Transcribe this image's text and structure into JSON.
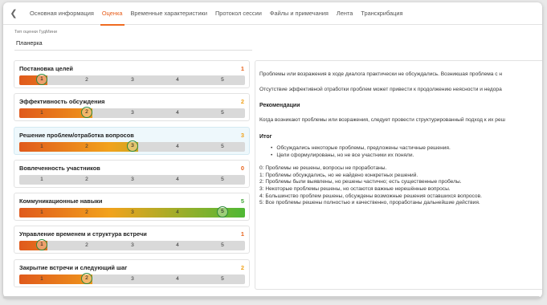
{
  "tabs": [
    {
      "label": "Основная информация",
      "active": false
    },
    {
      "label": "Оценка",
      "active": true
    },
    {
      "label": "Временные характеристики",
      "active": false
    },
    {
      "label": "Протокол сессии",
      "active": false
    },
    {
      "label": "Файлы и примечания",
      "active": false
    },
    {
      "label": "Лента",
      "active": false
    },
    {
      "label": "Транскрибация",
      "active": false
    }
  ],
  "meeting_type": {
    "label": "Тип оценки ГудМини",
    "value": "Планерка"
  },
  "scale_labels": [
    "1",
    "2",
    "3",
    "4",
    "5"
  ],
  "colors": {
    "accent": "#ef6b21",
    "low": "#e05a1c",
    "mid": "#f2a21c",
    "high": "#4fb835",
    "track": "#d9d9d9"
  },
  "criteria": [
    {
      "title": "Постановка целей",
      "score": "1",
      "value": 1,
      "score_color": "#e8631c",
      "selected": false
    },
    {
      "title": "Эффективность обсуждения",
      "score": "2",
      "value": 2,
      "score_color": "#f0a11a",
      "selected": false
    },
    {
      "title": "Решение проблем/отработка вопросов",
      "score": "3",
      "value": 3,
      "score_color": "#f0a11a",
      "selected": true
    },
    {
      "title": "Вовлеченность участников",
      "score": "0",
      "value": 0,
      "score_color": "#e8631c",
      "selected": false
    },
    {
      "title": "Коммуникационные навыки",
      "score": "5",
      "value": 5,
      "score_color": "#45a83a",
      "selected": false
    },
    {
      "title": "Управление временем и структура встречи",
      "score": "1",
      "value": 1,
      "score_color": "#e8631c",
      "selected": false
    },
    {
      "title": "Закрытие встречи и следующий шаг",
      "score": "2",
      "value": 2,
      "score_color": "#f0a11a",
      "selected": false
    }
  ],
  "panel": {
    "p1": "Проблемы или возражения в ходе диалога практически не обсуждались. Возникшая проблема с н",
    "p2": "Отсутствие эффективной отработки проблем может привести к продолжению неясности и недора",
    "rec_heading": "Рекомендации",
    "rec_text": "Когда возникают проблемы или возражения, следует провести структурированный подход к их реш",
    "summary_heading": "Итог",
    "bullets": [
      "Обсуждались некоторые проблемы, предложены частичные решения.",
      "Цели сформулированы, но не все участники их поняли."
    ],
    "legend": [
      "0: Проблемы не решены, вопросы не проработаны.",
      "1: Проблемы обсуждались, но не найдено конкретных решений.",
      "2: Проблемы были выявлены, но решены частично; есть существенные пробелы.",
      "3: Некоторые проблемы решены, но остаются важные нерешённые вопросы.",
      "4: Большинство проблем решены, обсуждены возможные решения оставшихся вопросов.",
      "5: Все проблемы решены полностью и качественно, проработаны дальнейшие действия."
    ]
  }
}
